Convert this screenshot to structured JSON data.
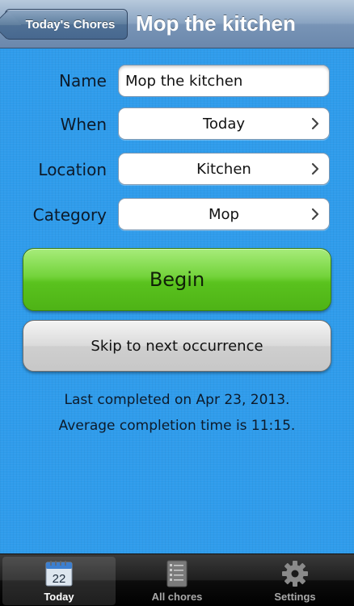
{
  "nav": {
    "back_label": "Today's Chores",
    "title": "Mop the kitchen"
  },
  "form": {
    "name_label": "Name",
    "name_value": "Mop the kitchen",
    "when_label": "When",
    "when_value": "Today",
    "location_label": "Location",
    "location_value": "Kitchen",
    "category_label": "Category",
    "category_value": "Mop"
  },
  "actions": {
    "begin_label": "Begin",
    "skip_label": "Skip to next occurrence"
  },
  "info": {
    "last_completed": "Last completed on Apr 23, 2013.",
    "average_time": "Average completion time is 11:15."
  },
  "tabbar": {
    "tabs": [
      {
        "label": "Today",
        "icon": "calendar-icon",
        "calendar_day": "22",
        "active": true
      },
      {
        "label": "All chores",
        "icon": "list-icon",
        "active": false
      },
      {
        "label": "Settings",
        "icon": "gear-icon",
        "active": false
      }
    ]
  },
  "colors": {
    "background": "#2f9ceb",
    "begin_button": "#5ac21e",
    "navbar": "#7894b6"
  }
}
